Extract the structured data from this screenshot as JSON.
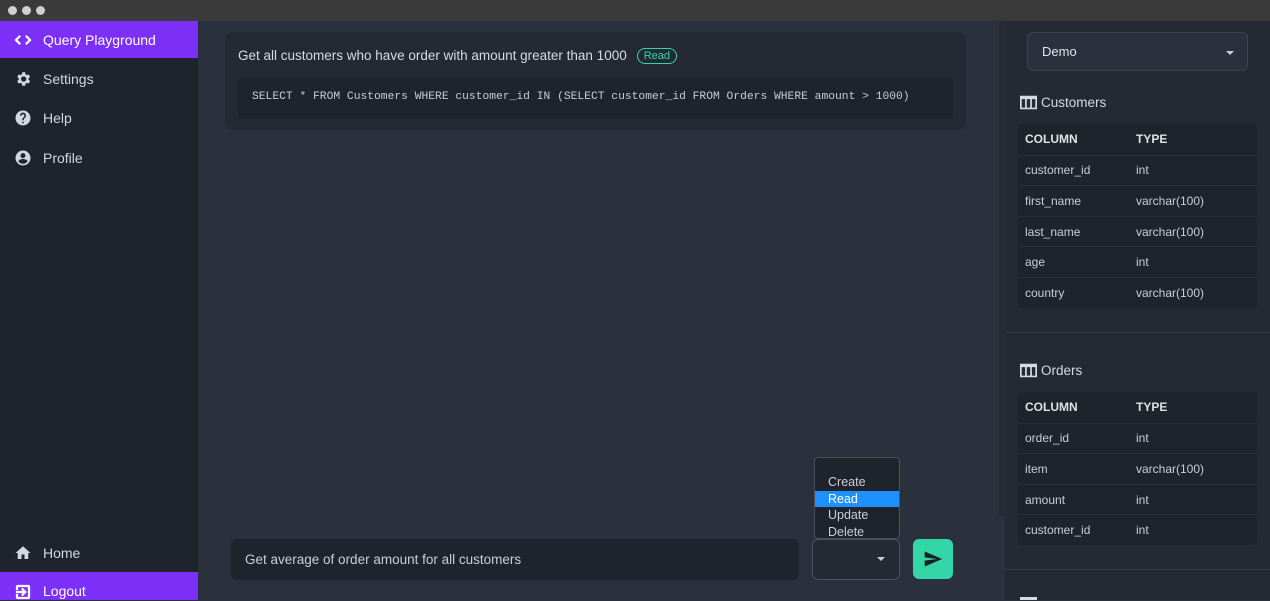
{
  "window": {
    "controls": [
      "close",
      "minimize",
      "maximize"
    ]
  },
  "sidebar": {
    "top_items": [
      {
        "label": "Query Playground",
        "icon": "code-icon",
        "active": true
      },
      {
        "label": "Settings",
        "icon": "gear-icon",
        "active": false
      },
      {
        "label": "Help",
        "icon": "help-icon",
        "active": false
      },
      {
        "label": "Profile",
        "icon": "profile-icon",
        "active": false
      }
    ],
    "bottom_items": [
      {
        "label": "Home",
        "icon": "home-icon",
        "active": false
      },
      {
        "label": "Logout",
        "icon": "logout-icon",
        "active": true
      }
    ]
  },
  "main": {
    "history": [
      {
        "question": "Get all customers who have order with amount greater than 1000",
        "badge": "Read",
        "sql": "SELECT * FROM Customers WHERE customer_id IN (SELECT customer_id FROM Orders WHERE amount > 1000)"
      }
    ],
    "input": {
      "value": "Get average of order amount for all customers"
    },
    "operation_select": {
      "options": [
        "Create",
        "Read",
        "Update",
        "Delete"
      ],
      "highlighted": "Read"
    }
  },
  "schema_panel": {
    "database_select": {
      "value": "Demo"
    },
    "tables": [
      {
        "name": "Customers",
        "columns_header": [
          "COLUMN",
          "TYPE"
        ],
        "rows": [
          [
            "customer_id",
            "int"
          ],
          [
            "first_name",
            "varchar(100)"
          ],
          [
            "last_name",
            "varchar(100)"
          ],
          [
            "age",
            "int"
          ],
          [
            "country",
            "varchar(100)"
          ]
        ]
      },
      {
        "name": "Orders",
        "columns_header": [
          "COLUMN",
          "TYPE"
        ],
        "rows": [
          [
            "order_id",
            "int"
          ],
          [
            "item",
            "varchar(100)"
          ],
          [
            "amount",
            "int"
          ],
          [
            "customer_id",
            "int"
          ]
        ]
      }
    ]
  },
  "colors": {
    "accent": "#7b2ff7",
    "success": "#33d6a6",
    "selection": "#1e90ff",
    "sidebar_bg": "#1f232b",
    "main_bg": "#2a303c"
  }
}
